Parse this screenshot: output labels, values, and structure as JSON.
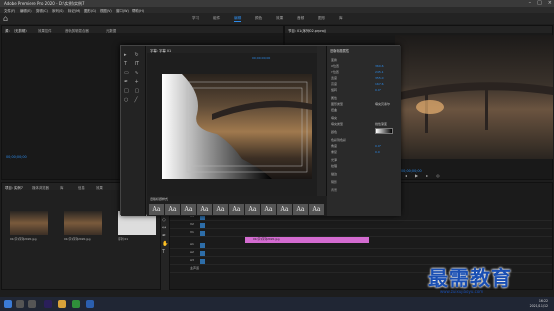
{
  "titlebar": {
    "title": "Adobe Premiere Pro 2020 - D:\\实例\\实例7",
    "controls": [
      "–",
      "□",
      "×"
    ]
  },
  "menubar": {
    "items": [
      "文件(F)",
      "编辑(E)",
      "剪辑(C)",
      "序列(S)",
      "标记(M)",
      "图形(G)",
      "视图(V)",
      "窗口(W)",
      "帮助(H)"
    ]
  },
  "workspace": {
    "tabs": [
      "学习",
      "组件",
      "编辑",
      "颜色",
      "效果",
      "音频",
      "图形",
      "库"
    ],
    "active_index": 2
  },
  "source_monitor": {
    "tabs": [
      "源：（无剪辑）",
      "效果控件",
      "音轨剪辑混合器",
      "元数据"
    ],
    "timecode": "00;00;00;00"
  },
  "program_monitor": {
    "title": "节目: 01(序列02.prproj)",
    "timecode": "00;00;00;00"
  },
  "project": {
    "tabs": [
      "项目: 实例7",
      "媒体浏览器",
      "库",
      "信息",
      "效果"
    ],
    "items": [
      "01(字)序列2020.jpg",
      "01(字)序列2020.jpg",
      "序列 01"
    ],
    "durations": [
      "5;00",
      "5;00",
      "5;00"
    ]
  },
  "timeline": {
    "track_labels": [
      "V3",
      "V2",
      "V1",
      "A1",
      "A2",
      "A3",
      "主声道"
    ],
    "clip_label": "01(字)序列2020.jpg",
    "timecode": "00;00;00;00"
  },
  "legacy_title": {
    "title": "字幕: 字幕 01",
    "panel_title": "旧版标题属性",
    "style_panel_title": "旧版标题样式",
    "properties": [
      {
        "label": "变换",
        "value": ""
      },
      {
        "label": "X位置",
        "value": "360.6"
      },
      {
        "label": "Y位置",
        "value": "245.1"
      },
      {
        "label": "宽度",
        "value": "355.0"
      },
      {
        "label": "高度",
        "value": "167.6"
      },
      {
        "label": "旋转",
        "value": "0.0°"
      },
      {
        "label": "属性",
        "value": ""
      },
      {
        "label": "图形类型",
        "value": "填充贝塞尔"
      },
      {
        "label": "扭曲",
        "value": ""
      },
      {
        "label": "填充",
        "value": ""
      },
      {
        "label": "填充类型",
        "value": "线性渐变"
      },
      {
        "label": "颜色",
        "value": ""
      },
      {
        "label": "色彩到色彩",
        "value": ""
      },
      {
        "label": "角度",
        "value": "0.0°"
      },
      {
        "label": "重复",
        "value": "0.0"
      },
      {
        "label": "光泽",
        "value": ""
      },
      {
        "label": "纹理",
        "value": ""
      },
      {
        "label": "描边",
        "value": ""
      },
      {
        "label": "阴影",
        "value": ""
      },
      {
        "label": "背景",
        "value": ""
      }
    ],
    "style_samples": [
      "Aa",
      "Aa",
      "Aa",
      "Aa",
      "Aa",
      "Aa",
      "Aa",
      "Aa",
      "Aa",
      "Aa",
      "Aa"
    ],
    "timecode": "00;00;00;00"
  },
  "taskbar": {
    "time": "16:22",
    "date": "2021/11/12"
  },
  "watermark": {
    "text": "最需教育",
    "url": "www.zuixujiaoyu.com"
  }
}
